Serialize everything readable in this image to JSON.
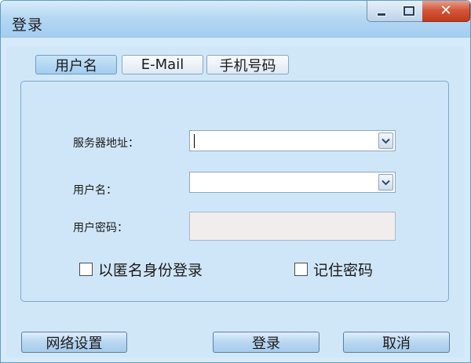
{
  "window": {
    "title": "登录",
    "controls": {
      "minimize_icon": "minimize-icon",
      "maximize_icon": "maximize-icon",
      "close_icon": "close-icon",
      "close_glyph": "✕"
    }
  },
  "tabs": [
    {
      "label": "用户名",
      "active": true
    },
    {
      "label": "E-Mail",
      "active": false
    },
    {
      "label": "手机号码",
      "active": false
    }
  ],
  "form": {
    "server": {
      "label": "服务器地址：",
      "value": ""
    },
    "username": {
      "label": "用户名：",
      "value": ""
    },
    "password": {
      "label": "用户密码：",
      "value": ""
    }
  },
  "options": {
    "anonymous": {
      "label": "以匿名身份登录",
      "checked": false
    },
    "remember": {
      "label": "记住密码",
      "checked": false
    }
  },
  "buttons": {
    "network": "网络设置",
    "login": "登录",
    "cancel": "取消"
  },
  "colors": {
    "window_bg": "#d6eaf9",
    "titlebar": "#b6d8f2",
    "close_button": "#c0391c",
    "password_bg": "#f2eded"
  }
}
